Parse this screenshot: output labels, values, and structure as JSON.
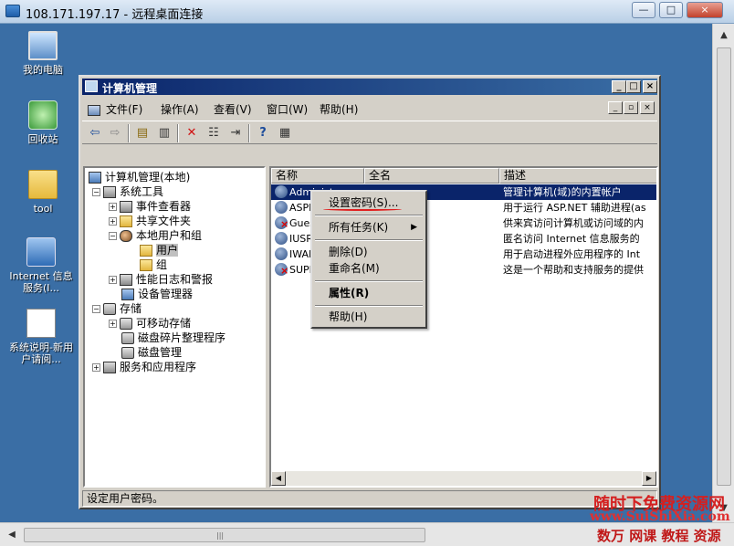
{
  "rdp": {
    "title": "108.171.197.17 - 远程桌面连接",
    "controls": [
      "—",
      "□",
      "×"
    ]
  },
  "desktop_icons": [
    {
      "label": "我的电脑",
      "icon": "computer-icon"
    },
    {
      "label": "回收站",
      "icon": "recycle-bin-icon"
    },
    {
      "label": "tool",
      "icon": "folder-icon"
    },
    {
      "label": "Internet 信息服务(I...",
      "icon": "iis-icon"
    },
    {
      "label": "系统说明-新用户请阅...",
      "icon": "document-icon"
    }
  ],
  "window": {
    "title": "计算机管理",
    "controls": [
      "_",
      "□",
      "×"
    ]
  },
  "menubar": [
    {
      "label": "文件(F)"
    },
    {
      "label": "操作(A)"
    },
    {
      "label": "查看(V)"
    },
    {
      "label": "窗口(W)"
    },
    {
      "label": "帮助(H)"
    }
  ],
  "mdi_controls": [
    "_",
    "▫",
    "×"
  ],
  "toolbar": [
    {
      "icon": "back-arrow-icon",
      "glyph": "⇦"
    },
    {
      "icon": "forward-arrow-icon",
      "glyph": "⇨"
    },
    {
      "icon": "up-folder-icon",
      "glyph": "▤"
    },
    {
      "icon": "show-hide-tree-icon",
      "glyph": "▥"
    },
    {
      "icon": "delete-icon",
      "glyph": "✕"
    },
    {
      "icon": "properties-icon",
      "glyph": "☷"
    },
    {
      "icon": "export-icon",
      "glyph": "⇥"
    },
    {
      "icon": "help-icon",
      "glyph": "?"
    },
    {
      "icon": "console-icon",
      "glyph": "▦"
    }
  ],
  "tree": [
    {
      "label": "计算机管理(本地)",
      "level": 0,
      "expander": "",
      "icon": "pc"
    },
    {
      "label": "系统工具",
      "level": 1,
      "expander": "−",
      "icon": "tool"
    },
    {
      "label": "事件查看器",
      "level": 2,
      "expander": "+",
      "icon": "tool"
    },
    {
      "label": "共享文件夹",
      "level": 2,
      "expander": "+",
      "icon": "folder"
    },
    {
      "label": "本地用户和组",
      "level": 2,
      "expander": "−",
      "icon": "users"
    },
    {
      "label": "用户",
      "level": 3,
      "expander": "",
      "icon": "folder",
      "selected": true
    },
    {
      "label": "组",
      "level": 3,
      "expander": "",
      "icon": "folder"
    },
    {
      "label": "性能日志和警报",
      "level": 2,
      "expander": "+",
      "icon": "tool"
    },
    {
      "label": "设备管理器",
      "level": 2,
      "expander": "",
      "icon": "pc"
    },
    {
      "label": "存储",
      "level": 1,
      "expander": "−",
      "icon": "disk"
    },
    {
      "label": "可移动存储",
      "level": 2,
      "expander": "+",
      "icon": "disk"
    },
    {
      "label": "磁盘碎片整理程序",
      "level": 2,
      "expander": "",
      "icon": "disk"
    },
    {
      "label": "磁盘管理",
      "level": 2,
      "expander": "",
      "icon": "disk"
    },
    {
      "label": "服务和应用程序",
      "level": 1,
      "expander": "+",
      "icon": "tool"
    }
  ],
  "list": {
    "columns": [
      "名称",
      "全名",
      "描述"
    ],
    "rows": [
      {
        "name": "Administr...",
        "fullname": "",
        "desc": "管理计算机(域)的内置帐户",
        "selected": true,
        "disabled": false
      },
      {
        "name": "ASPN...",
        "fullname": "算机帐户",
        "desc": "用于运行 ASP.NET 辅助进程(as",
        "selected": false,
        "disabled": false
      },
      {
        "name": "Gues...",
        "fullname": "",
        "desc": "供来宾访问计算机或访问域的内",
        "selected": false,
        "disabled": true
      },
      {
        "name": "IUSR...",
        "fullname": "宾帐户",
        "desc": "匿名访问 Internet 信息服务的",
        "selected": false,
        "disabled": false
      },
      {
        "name": "IWAM...",
        "fullname": "程帐户",
        "desc": "用于启动进程外应用程序的 Int",
        "selected": false,
        "disabled": false
      },
      {
        "name": "SUPP...",
        "fullname": "t Corpora...",
        "desc": "这是一个帮助和支持服务的提供",
        "selected": false,
        "disabled": true
      }
    ]
  },
  "status": "设定用户密码。",
  "context_menu": {
    "items": [
      {
        "label": "设置密码(S)...",
        "bold": false
      },
      {
        "sep": true
      },
      {
        "label": "所有任务(K)",
        "bold": false,
        "submenu": true
      },
      {
        "sep": true
      },
      {
        "label": "删除(D)",
        "bold": false
      },
      {
        "label": "重命名(M)",
        "bold": false
      },
      {
        "sep": true
      },
      {
        "label": "属性(R)",
        "bold": true
      },
      {
        "sep": true
      },
      {
        "label": "帮助(H)",
        "bold": false
      }
    ]
  },
  "watermark": {
    "line1": "随时下免费资源网",
    "line2": "www.SuiShiXia.com",
    "line3": "数万 网课 教程 资源"
  },
  "scrollbar": {
    "grip": "|||"
  }
}
